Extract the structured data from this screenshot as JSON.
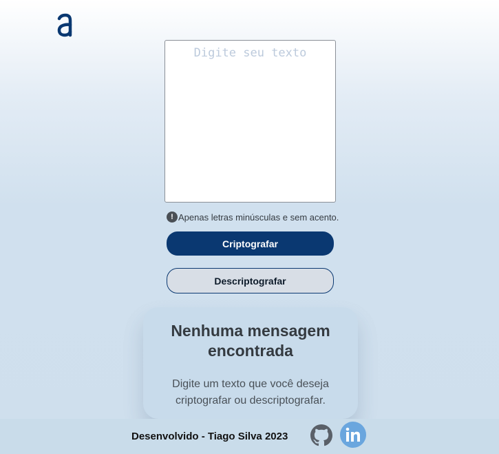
{
  "logo": {
    "icon": "alura-a-logo-icon",
    "color": "#0a3871"
  },
  "input": {
    "placeholder": "Digite seu texto",
    "value": ""
  },
  "hint": {
    "icon": "exclamation-circle-icon",
    "text": "Apenas letras minúsculas e sem acento."
  },
  "buttons": {
    "encrypt_label": "Criptografar",
    "decrypt_label": "Descriptografar"
  },
  "output_card": {
    "title": "Nenhuma mensagem encontrada",
    "text": "Digite um texto que você deseja criptografar ou descriptografar."
  },
  "footer": {
    "text": "Desenvolvido - Tiago Silva 2023",
    "icons": [
      "github-icon",
      "linkedin-icon"
    ]
  },
  "colors": {
    "accent": "#0a3871",
    "secondary_button_bg": "#d8dee6",
    "linkedin": "#6aa6de"
  }
}
